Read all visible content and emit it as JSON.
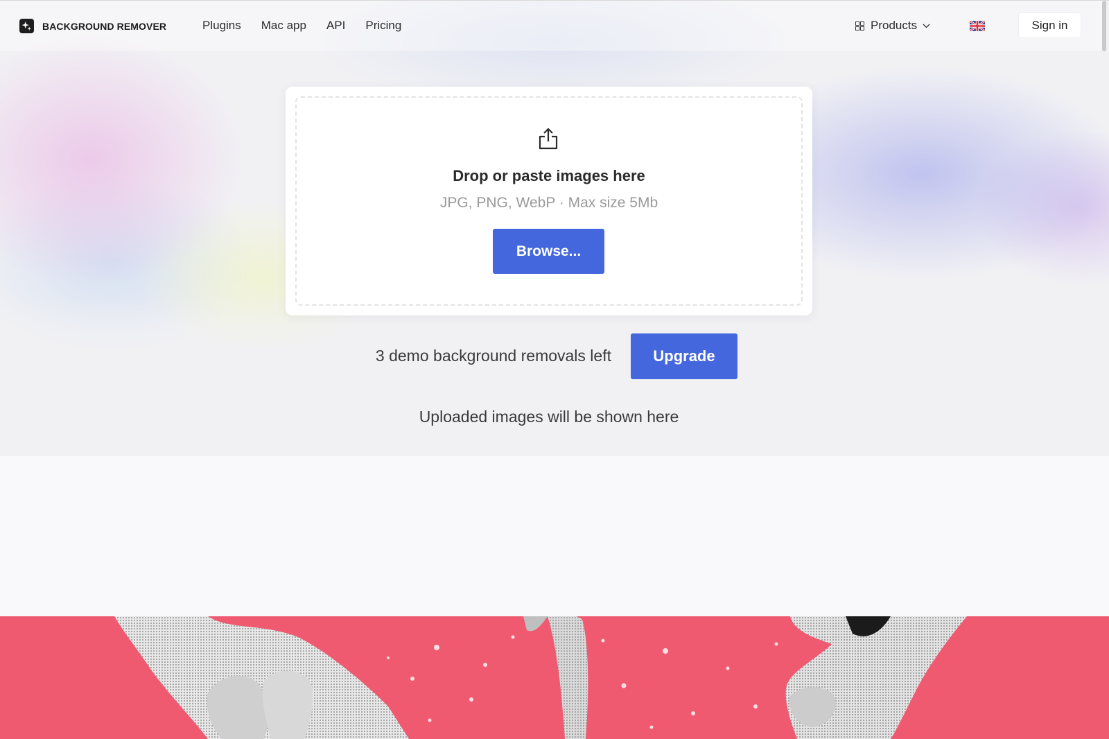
{
  "header": {
    "logo_text": "BACKGROUND REMOVER",
    "nav": [
      {
        "label": "Plugins"
      },
      {
        "label": "Mac app"
      },
      {
        "label": "API"
      },
      {
        "label": "Pricing"
      }
    ],
    "products_label": "Products",
    "signin_label": "Sign in"
  },
  "upload": {
    "title": "Drop or paste images here",
    "subtitle": "JPG, PNG, WebP · Max size 5Mb",
    "browse_label": "Browse..."
  },
  "demo": {
    "remaining_text": "3 demo background removals left",
    "upgrade_label": "Upgrade"
  },
  "uploaded_note": "Uploaded images will be shown here",
  "colors": {
    "accent": "#4467dd",
    "banner": "#ef5a70"
  },
  "icons": {
    "logo": "sparkle-logo-icon",
    "products": "grid-icon",
    "products_chevron": "chevron-down-icon",
    "language": "uk-flag-icon",
    "upload": "upload-icon"
  }
}
